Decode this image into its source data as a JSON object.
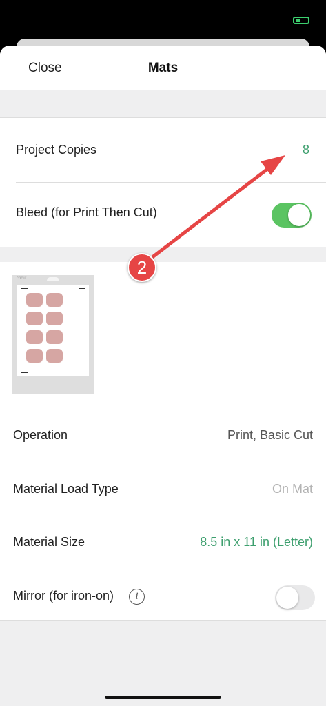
{
  "nav": {
    "close_label": "Close",
    "title": "Mats"
  },
  "copies": {
    "label": "Project Copies",
    "value": "8"
  },
  "bleed": {
    "label": "Bleed (for Print Then Cut)",
    "enabled": true
  },
  "mat_preview": {
    "brand": "cricut"
  },
  "details": {
    "operation": {
      "label": "Operation",
      "value": "Print, Basic Cut"
    },
    "load_type": {
      "label": "Material Load Type",
      "value": "On Mat"
    },
    "size": {
      "label": "Material Size",
      "value": "8.5 in x 11 in (Letter)"
    },
    "mirror": {
      "label": "Mirror (for iron-on)",
      "info_glyph": "i",
      "enabled": false
    }
  },
  "annotation": {
    "step_number": "2"
  },
  "colors": {
    "accent_green": "#3d9f6e",
    "toggle_on": "#5bc462",
    "annotation_red": "#e64545",
    "muted_text": "#b3b3b3"
  }
}
